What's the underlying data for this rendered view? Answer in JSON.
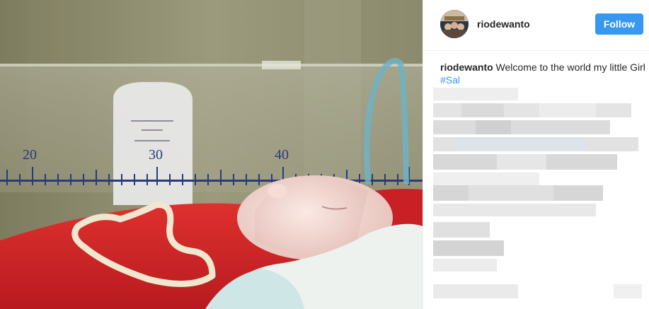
{
  "post": {
    "username": "riodewanto",
    "follow_label": "Follow",
    "caption": {
      "username": "riodewanto",
      "text": " Welcome to the world my little Girl ",
      "hashtag": "#Sal"
    }
  },
  "photo": {
    "ruler_numbers": [
      "20",
      "30",
      "40"
    ],
    "colors": {
      "blanket": "#d9262b",
      "cord": "#efe6cf",
      "skin": "#f2dcd6",
      "follow_button": "#3897f0",
      "hashtag": "#3897f0"
    }
  },
  "icons": {
    "avatar": "profile-avatar-icon"
  }
}
